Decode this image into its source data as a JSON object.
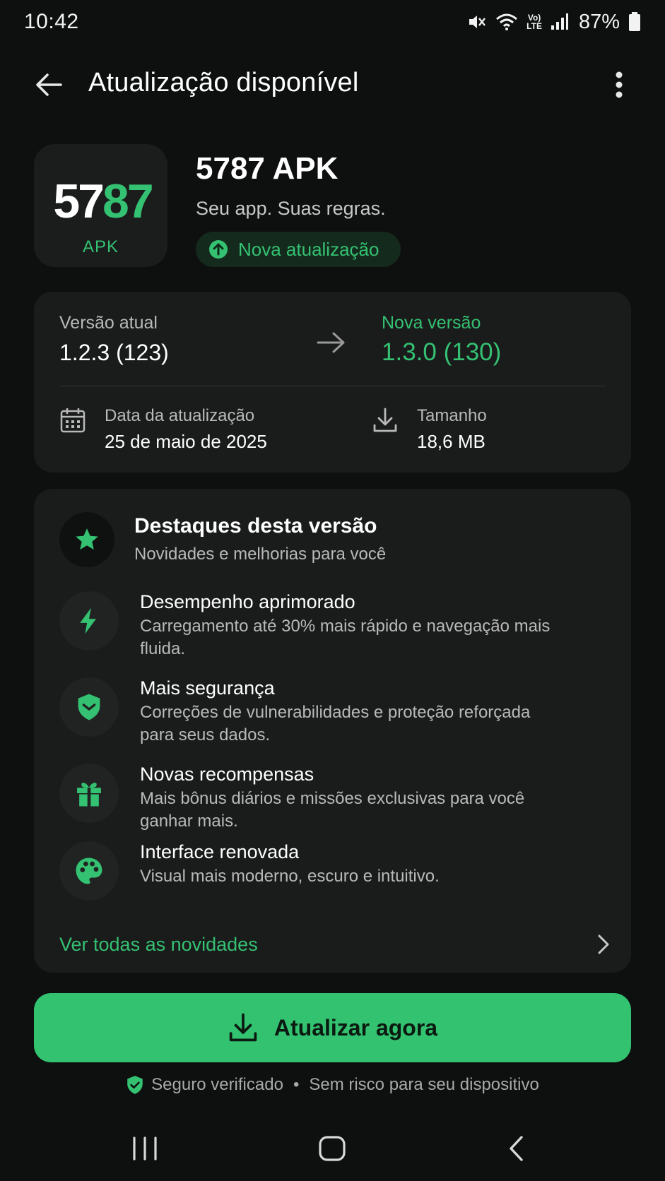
{
  "status": {
    "time": "10:42",
    "volte_top": "Vo)",
    "volte_bottom": "LTE",
    "battery": "87%"
  },
  "header": {
    "title": "Atualização disponível",
    "back_icon": "arrow-left-icon",
    "more_icon": "more-vert-icon"
  },
  "app": {
    "icon_num_white": "57",
    "icon_num_green": "87",
    "icon_sub": "APK",
    "name": "5787 APK",
    "tagline": "Seu app. Suas regras.",
    "badge": "Nova atualização"
  },
  "version": {
    "current_label": "Versão atual",
    "current_value": "1.2.3 (123)",
    "new_label": "Nova versão",
    "new_value": "1.3.0 (130)",
    "date_label": "Data da atualização",
    "date_value": "25 de maio de 2025",
    "size_label": "Tamanho",
    "size_value": "18,6 MB"
  },
  "highlights": {
    "title": "Destaques desta versão",
    "subtitle": "Novidades e melhorias para você",
    "items": [
      {
        "icon": "bolt-icon",
        "title": "Desempenho aprimorado",
        "desc": "Carregamento até 30% mais rápido e navegação mais fluida."
      },
      {
        "icon": "shield-icon",
        "title": "Mais segurança",
        "desc": "Correções de vulnerabilidades e proteção reforçada para seus dados."
      },
      {
        "icon": "gift-icon",
        "title": "Novas recompensas",
        "desc": "Mais bônus diários e missões exclusivas para você ganhar mais."
      },
      {
        "icon": "palette-icon",
        "title": "Interface renovada",
        "desc": "Visual mais moderno, escuro e intuitivo."
      }
    ],
    "see_all": "Ver todas as novidades"
  },
  "action": {
    "update_label": "Atualizar agora"
  },
  "footer": {
    "safe_text": "Seguro verificado",
    "separator": "•",
    "risk_text": "Sem risco para seu dispositivo"
  },
  "colors": {
    "accent": "#34c172",
    "background": "#0e0f0f",
    "card": "#1a1b1b"
  }
}
